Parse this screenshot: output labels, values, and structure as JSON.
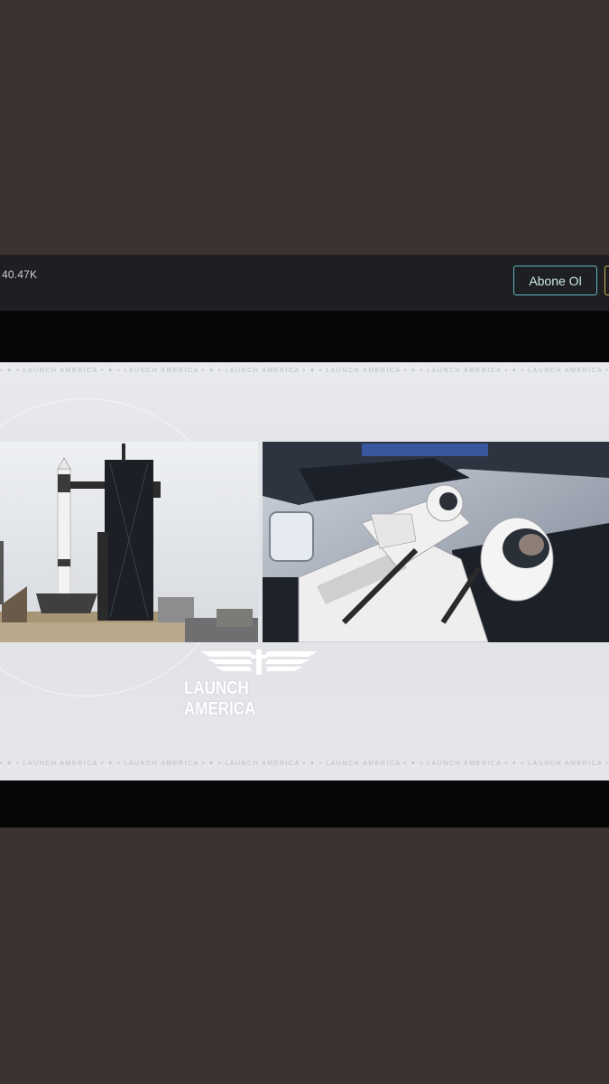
{
  "channel": {
    "viewer_count": "40.47K",
    "subscribe_label": "Abone Ol"
  },
  "broadcast": {
    "logo_text": "LAUNCH AMERICA",
    "ticker_text": "• ✦ •  LAUNCH AMERICA  • ✦ •  LAUNCH AMERICA  • ✦ •  LAUNCH AMERICA  • ✦ •  LAUNCH AMERICA  • ✦ •  LAUNCH AMERICA  • ✦ •  LAUNCH AMERICA  • ✦ •  LAUNCH AMERICA  • ✦ •",
    "left_feed": "launch-pad-rocket-image",
    "right_feed": "crew-cabin-astronauts-image"
  },
  "colors": {
    "background": "#3b3331",
    "bar": "#1e1f22",
    "subscribe_border": "#5fb7c0",
    "video": "#060606"
  }
}
